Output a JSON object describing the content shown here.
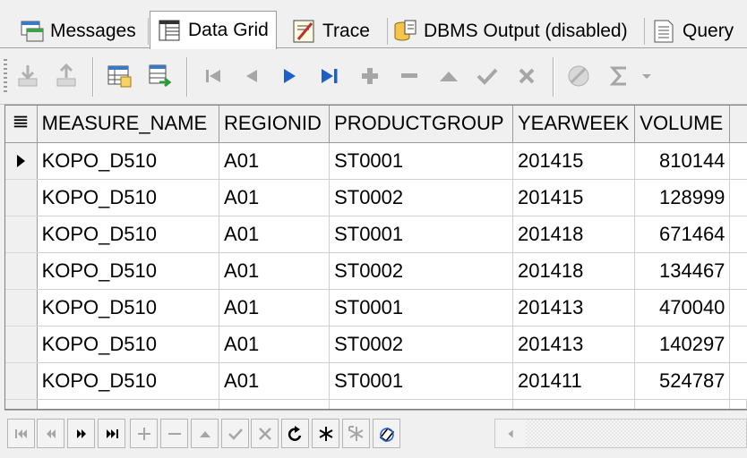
{
  "tabs": [
    {
      "label": "Messages",
      "icon": "messages-icon",
      "active": false
    },
    {
      "label": "Data Grid",
      "icon": "data-grid-icon",
      "active": true
    },
    {
      "label": "Trace",
      "icon": "trace-icon",
      "active": false
    },
    {
      "label": "DBMS Output (disabled)",
      "icon": "dbms-output-icon",
      "active": false
    },
    {
      "label": "Query",
      "icon": "query-icon",
      "active": false
    }
  ],
  "grid": {
    "columns": [
      "MEASURE_NAME",
      "REGIONID",
      "PRODUCTGROUP",
      "YEARWEEK",
      "VOLUME"
    ],
    "rows": [
      [
        "KOPO_D510",
        "A01",
        "ST0001",
        "201415",
        "810144"
      ],
      [
        "KOPO_D510",
        "A01",
        "ST0002",
        "201415",
        "128999"
      ],
      [
        "KOPO_D510",
        "A01",
        "ST0001",
        "201418",
        "671464"
      ],
      [
        "KOPO_D510",
        "A01",
        "ST0002",
        "201418",
        "134467"
      ],
      [
        "KOPO_D510",
        "A01",
        "ST0001",
        "201413",
        "470040"
      ],
      [
        "KOPO_D510",
        "A01",
        "ST0002",
        "201413",
        "140297"
      ],
      [
        "KOPO_D510",
        "A01",
        "ST0001",
        "201411",
        "524787"
      ]
    ],
    "current_row": 0
  },
  "colors": {
    "accent_blue": "#1f5fc8",
    "disabled_gray": "#a6a6a6"
  }
}
